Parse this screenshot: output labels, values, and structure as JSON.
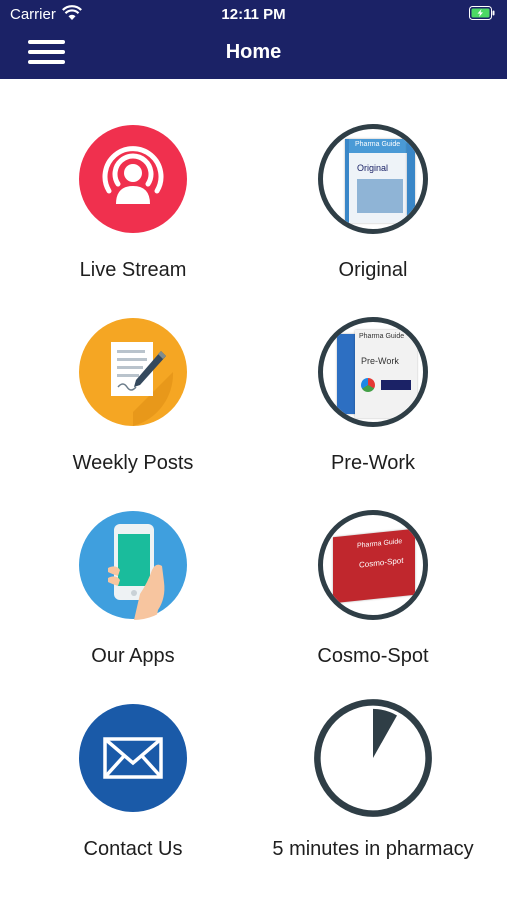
{
  "status_bar": {
    "carrier": "Carrier",
    "time": "12:11 PM"
  },
  "header": {
    "title": "Home"
  },
  "tiles": [
    {
      "label": "Live Stream",
      "icon": "live-stream-icon"
    },
    {
      "label": "Original",
      "icon": "original-book-icon",
      "book_brand": "Pharma Guide",
      "book_title": "Original"
    },
    {
      "label": "Weekly Posts",
      "icon": "document-pen-icon"
    },
    {
      "label": "Pre-Work",
      "icon": "pre-work-book-icon",
      "book_brand": "Pharma Guide",
      "book_title": "Pre-Work"
    },
    {
      "label": "Our Apps",
      "icon": "phone-hand-icon"
    },
    {
      "label": "Cosmo-Spot",
      "icon": "cosmo-spot-book-icon",
      "book_brand": "Pharma Guide",
      "book_title": "Cosmo-Spot"
    },
    {
      "label": "Contact Us",
      "icon": "envelope-icon"
    },
    {
      "label": "5 minutes in pharmacy",
      "icon": "timer-icon"
    }
  ],
  "colors": {
    "header_bg": "#1b2266",
    "live_stream": "#f0304e",
    "weekly_posts": "#f5a623",
    "our_apps": "#3f9fde",
    "contact_us": "#1a5aa8",
    "ring": "#2f3e46"
  }
}
